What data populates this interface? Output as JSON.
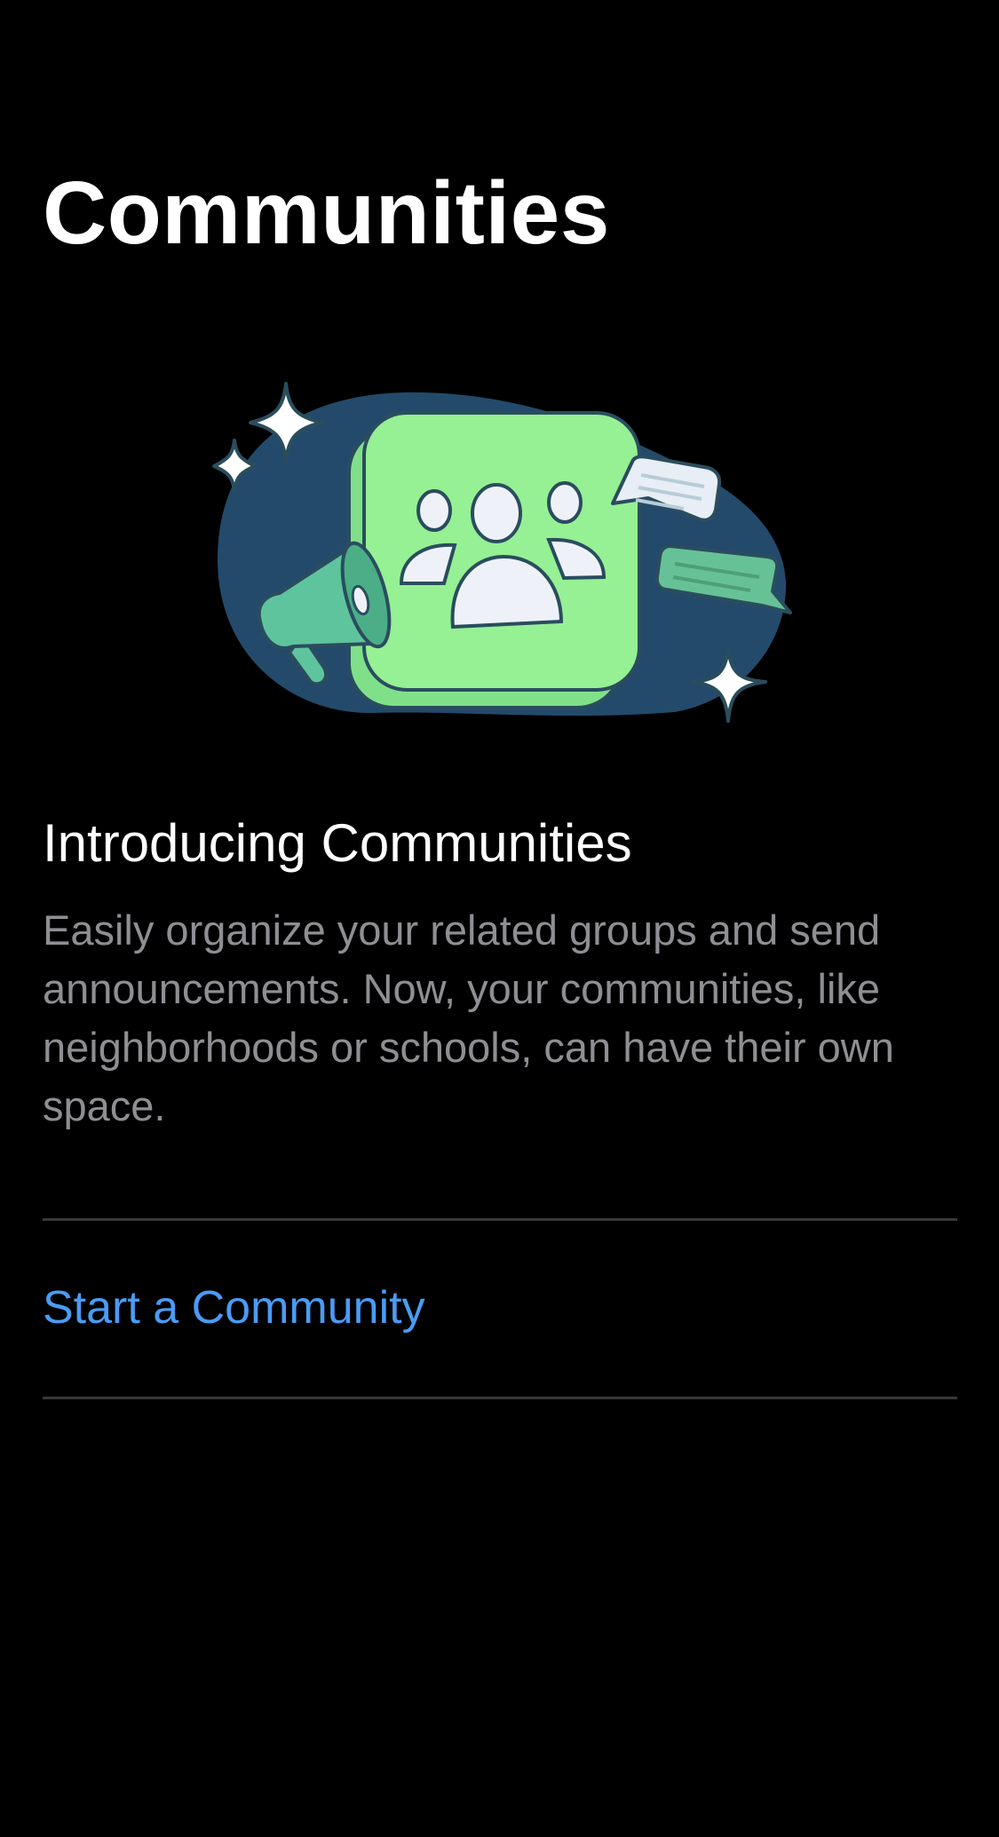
{
  "header": {
    "title": "Communities"
  },
  "illustration": {
    "icon": "communities-illustration",
    "colors": {
      "blob": "#234a6a",
      "card": "#96f094",
      "card_back": "#80e08a",
      "outline": "#2a4d5e",
      "people": "#eef2f8",
      "megaphone": "#5ec49e",
      "bubble_light": "#e8eef5",
      "bubble_green": "#66c296",
      "sparkle": "#ffffff"
    }
  },
  "intro": {
    "heading": "Introducing Communities",
    "body": "Easily organize your related groups and send announcements. Now, your communities, like neighborhoods or schools, can have their own space."
  },
  "actions": {
    "start_community": "Start a Community"
  },
  "theme": {
    "background": "#000000",
    "text_primary": "#ffffff",
    "text_secondary": "#8e8e93",
    "link": "#4a9bf5",
    "divider": "#38383a"
  }
}
